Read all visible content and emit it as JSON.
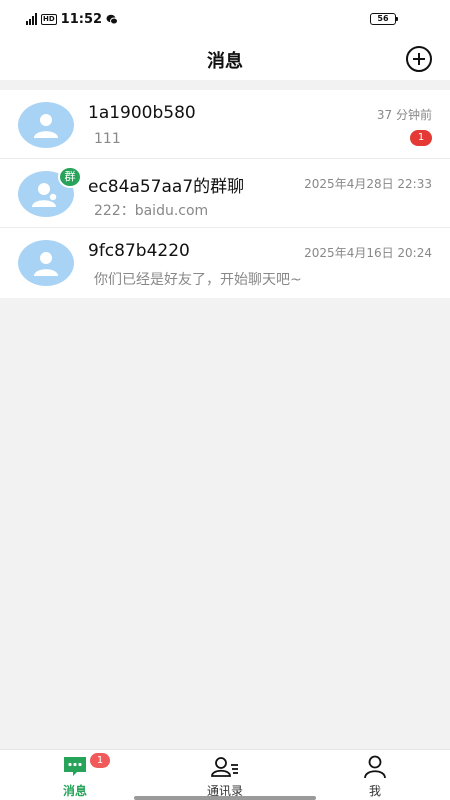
{
  "status_bar": {
    "network": "5G",
    "hd": "HD",
    "time": "11:52",
    "battery": "56"
  },
  "header": {
    "title": "消息"
  },
  "conversations": [
    {
      "name": "1a1900b580",
      "time": "37 分钟前",
      "preview": "111",
      "unread": "1",
      "is_group": false
    },
    {
      "name": "ec84a57aa7的群聊",
      "time": "2025年4月28日 22:33",
      "preview": "222：baidu.com",
      "group_badge": "群",
      "is_group": true
    },
    {
      "name": "9fc87b4220",
      "time": "2025年4月16日 20:24",
      "preview": "你们已经是好友了，开始聊天吧~",
      "is_group": false
    }
  ],
  "tabs": [
    {
      "label": "消息",
      "badge": "1",
      "icon": "chat-bubble-icon",
      "active": true
    },
    {
      "label": "通讯录",
      "icon": "contacts-icon",
      "active": false
    },
    {
      "label": "我",
      "icon": "person-icon",
      "active": false
    }
  ],
  "colors": {
    "accent": "#27a35a",
    "badge": "#e53935",
    "avatar_bg": "#a9d3f5"
  }
}
